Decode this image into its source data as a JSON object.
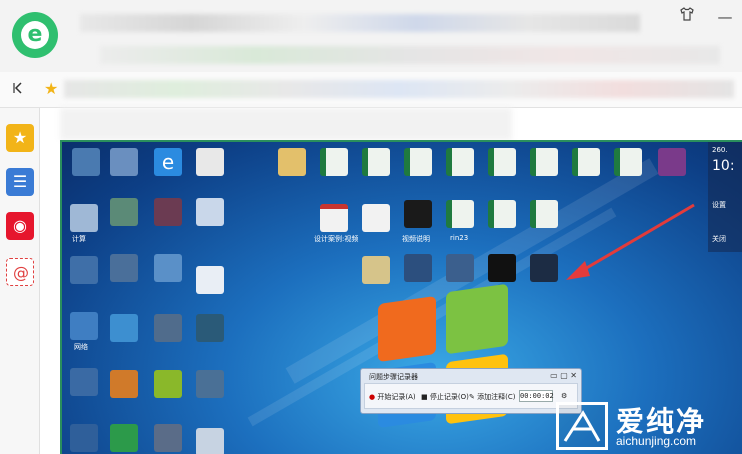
{
  "browser": {
    "logo_letter": "e",
    "skin_icon": "shirt-icon",
    "minimize_label": "—",
    "back_icon": "back-icon",
    "favorite_icon": "star-icon"
  },
  "sidebar": {
    "items": [
      {
        "name": "favorites-icon",
        "color": "#f2b418"
      },
      {
        "name": "news-icon",
        "color": "#3a7bd5"
      },
      {
        "name": "weibo-icon",
        "color": "#e6162d"
      },
      {
        "name": "mail-icon",
        "color": "#e04040"
      }
    ]
  },
  "desktop": {
    "icon_labels": [
      "计算",
      "设计案例:视频",
      "视频说明",
      "rin23",
      "网络"
    ],
    "recorder": {
      "title": "问题步骤记录器",
      "start_label": "开始记录(A)",
      "stop_label": "停止记录(O)",
      "comment_label": "添加注释(C)",
      "timer": "00:00:02"
    },
    "gadget": {
      "time": "10:",
      "lines": [
        "260.",
        "设置",
        "关闭"
      ]
    }
  },
  "watermark": {
    "chinese": "爱纯净",
    "domain": "aichunjing.com"
  },
  "colors": {
    "accent_green": "#2fbf6f",
    "arrow_red": "#e33b3b",
    "desktop_blue": "#1c6fbe"
  }
}
